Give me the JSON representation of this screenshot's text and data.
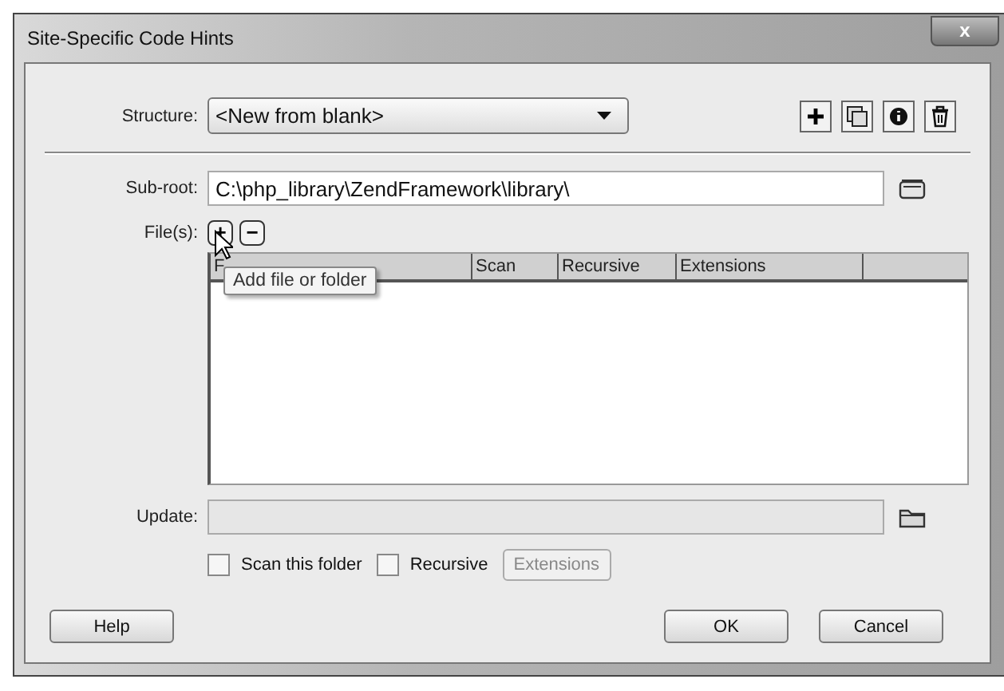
{
  "window": {
    "title": "Site-Specific Code Hints",
    "close_label": "x"
  },
  "structure": {
    "label": "Structure:",
    "value": "<New from blank>"
  },
  "sub_root": {
    "label": "Sub-root:",
    "value": "C:\\php_library\\ZendFramework\\library\\"
  },
  "files": {
    "label": "File(s):",
    "add_label": "+",
    "remove_label": "−",
    "tooltip": "Add file or folder",
    "columns": [
      {
        "label": "F"
      },
      {
        "label": "Scan"
      },
      {
        "label": "Recursive"
      },
      {
        "label": "Extensions"
      }
    ]
  },
  "update": {
    "label": "Update:",
    "disabled": true
  },
  "options": [
    {
      "label": "Scan this folder",
      "checked": false
    },
    {
      "label": "Recursive",
      "checked": false
    }
  ],
  "extensions_button": {
    "label": "Extensions",
    "disabled": true
  },
  "buttons": [
    {
      "label": "Help"
    },
    {
      "label": "OK"
    },
    {
      "label": "Cancel"
    }
  ]
}
